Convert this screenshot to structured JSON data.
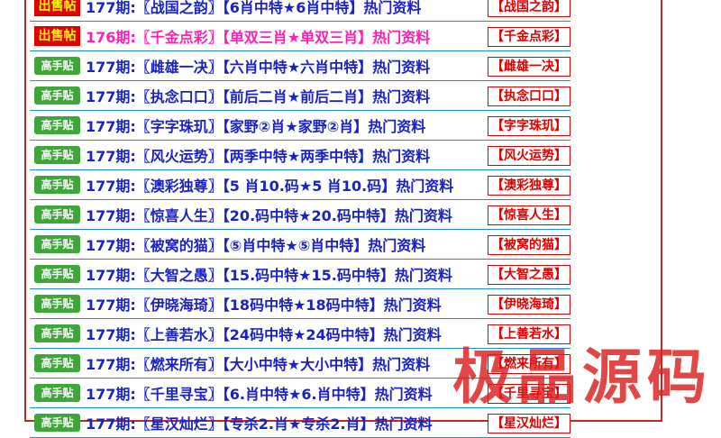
{
  "rows": [
    {
      "badge": "出售帖",
      "badge_style": "red",
      "text": "177期:〖战国之韵〗【6肖中特★6肖中特】热门资料",
      "text_style": "blue",
      "tag": "【战国之韵】"
    },
    {
      "badge": "出售帖",
      "badge_style": "red",
      "text": "176期:〖千金点彩〗【单双三肖★单双三肖】热门资料",
      "text_style": "pink",
      "tag": "【千金点彩】"
    },
    {
      "badge": "高手贴",
      "badge_style": "green",
      "text": "177期:〖雌雄一决〗【六肖中特★六肖中特】热门资料",
      "text_style": "blue",
      "tag": "【雌雄一决】"
    },
    {
      "badge": "高手贴",
      "badge_style": "green",
      "text": "177期:〖执念口口〗【前后二肖★前后二肖】热门资料",
      "text_style": "blue",
      "tag": "【执念口口】"
    },
    {
      "badge": "高手贴",
      "badge_style": "green",
      "text": "177期:〖字字珠玑〗【家野②肖★家野②肖】热门资料",
      "text_style": "blue",
      "tag": "【字字珠玑】"
    },
    {
      "badge": "高手贴",
      "badge_style": "green",
      "text": "177期:〖风火运势〗【两季中特★两季中特】热门资料",
      "text_style": "blue",
      "tag": "【风火运势】"
    },
    {
      "badge": "高手贴",
      "badge_style": "green",
      "text": "177期:〖澳彩独尊〗【5 肖10.码★5 肖10.码】热门资料",
      "text_style": "blue",
      "tag": "【澳彩独尊】"
    },
    {
      "badge": "高手贴",
      "badge_style": "green",
      "text": "177期:〖惊喜人生〗【20.码中特★20.码中特】热门资料",
      "text_style": "blue",
      "tag": "【惊喜人生】"
    },
    {
      "badge": "高手贴",
      "badge_style": "green",
      "text": "177期:〖被窝的猫〗【⑤肖中特★⑤肖中特】热门资料",
      "text_style": "blue",
      "tag": "【被窝的猫】"
    },
    {
      "badge": "高手贴",
      "badge_style": "green",
      "text": "177期:〖大智之愚〗【15.码中特★15.码中特】热门资料",
      "text_style": "blue",
      "tag": "【大智之愚】"
    },
    {
      "badge": "高手贴",
      "badge_style": "green",
      "text": "177期:〖伊晓海琦〗【18码中特★18码中特】热门资料",
      "text_style": "blue",
      "tag": "【伊晓海琦】"
    },
    {
      "badge": "高手贴",
      "badge_style": "green",
      "text": "177期:〖上善若水〗【24码中特★24码中特】热门资料",
      "text_style": "blue",
      "tag": "【上善若水】"
    },
    {
      "badge": "高手贴",
      "badge_style": "green",
      "text": "177期:〖燃来所有〗【大小中特★大小中特】热门资料",
      "text_style": "blue",
      "tag": "【燃来所有】"
    },
    {
      "badge": "高手贴",
      "badge_style": "green",
      "text": "177期:〖千里寻宝〗【6.肖中特★6.肖中特】热门资料",
      "text_style": "blue",
      "tag": "【千里寻宝】"
    },
    {
      "badge": "高手贴",
      "badge_style": "green",
      "text": "177期:〖星汉灿烂〗【专杀2.肖★专杀2.肖】热门资料",
      "text_style": "blue",
      "tag": "【星汉灿烂】"
    }
  ],
  "watermark": "极品源码"
}
